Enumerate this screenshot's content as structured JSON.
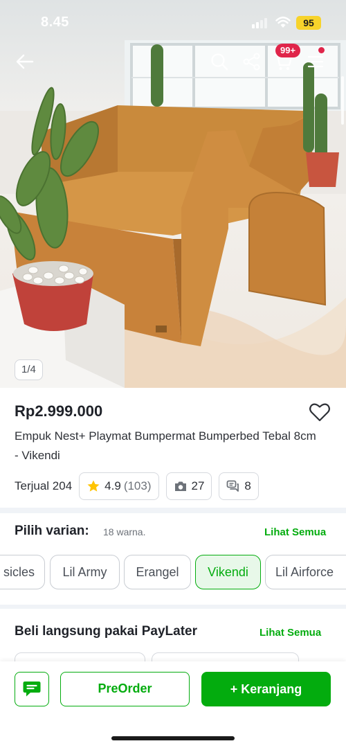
{
  "status_bar": {
    "time": "8.45",
    "battery": "95"
  },
  "nav": {
    "cart_badge": "99+",
    "icons": [
      "back-arrow-icon",
      "search-icon",
      "share-icon",
      "cart-icon",
      "menu-icon"
    ]
  },
  "gallery": {
    "counter": "1/4"
  },
  "product": {
    "price": "Rp2.999.000",
    "title": "Empuk Nest+ Playmat Bumpermat Bumperbed Tebal 8cm - Vikendi",
    "sold": "Terjual 204",
    "rating": "4.9",
    "rating_count": "(103)",
    "photo_reviews": "27",
    "discussions": "8"
  },
  "variants": {
    "title": "Pilih varian:",
    "subtitle": "18 warna.",
    "see_all": "Lihat Semua",
    "options": [
      {
        "label": "sicles",
        "selected": false
      },
      {
        "label": "Lil Army",
        "selected": false
      },
      {
        "label": "Erangel",
        "selected": false
      },
      {
        "label": "Vikendi",
        "selected": true
      },
      {
        "label": "Lil Airforce",
        "selected": false
      }
    ]
  },
  "paylater": {
    "title": "Beli langsung pakai PayLater",
    "see_all": "Lihat Semua"
  },
  "actions": {
    "preorder": "PreOrder",
    "add_to_cart": "+ Keranjang"
  },
  "colors": {
    "brand_green": "#03ac0e",
    "badge_red": "#e0254a",
    "battery_yellow": "#f7d32b",
    "star_yellow": "#ffc400"
  }
}
